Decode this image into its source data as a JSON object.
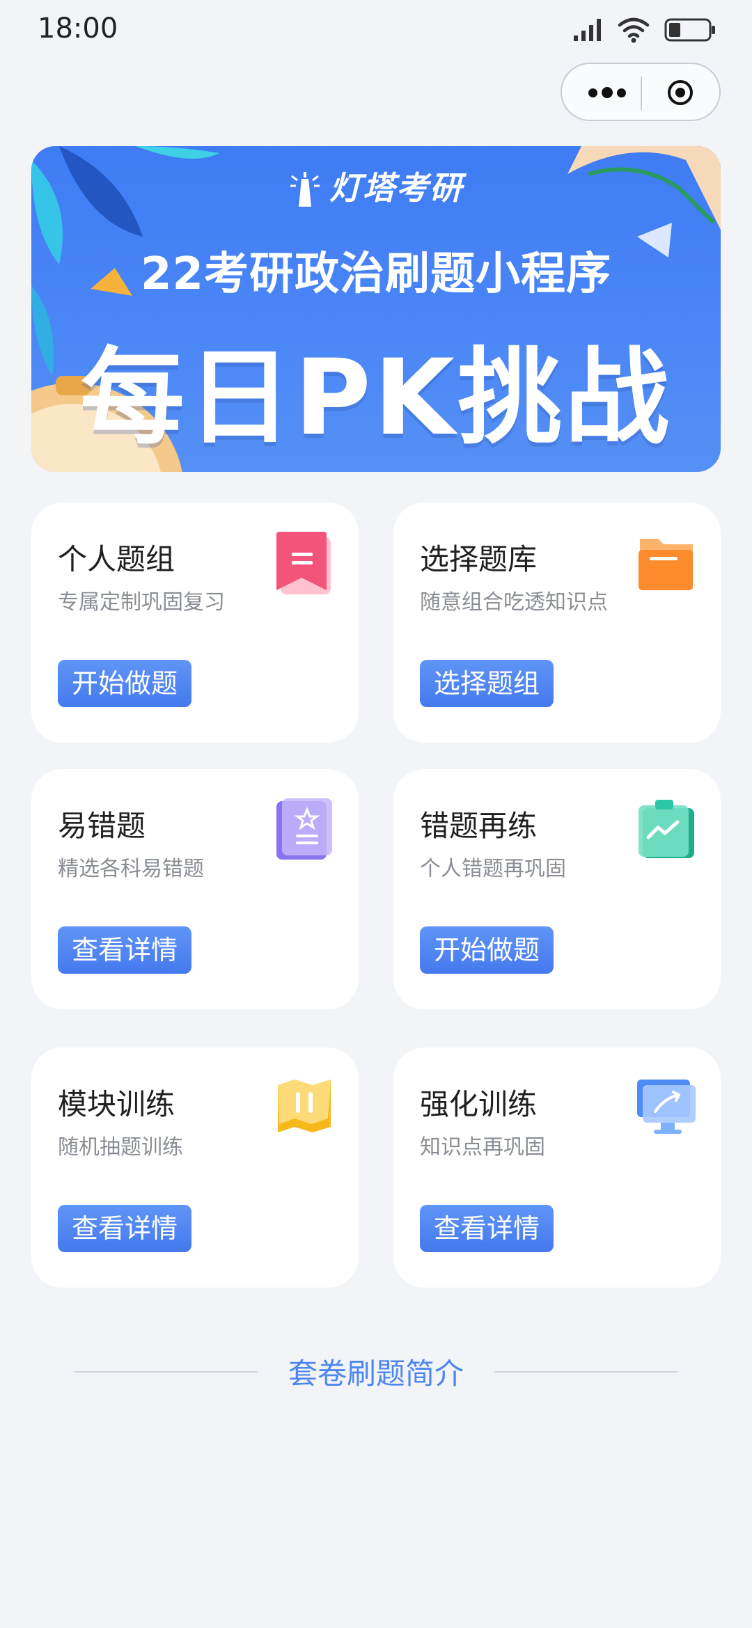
{
  "status_bar": {
    "time": "18:00",
    "icons": [
      "signal-icon",
      "wifi-icon",
      "battery-icon"
    ]
  },
  "capsule": {
    "icons": [
      "more-icon",
      "close-target-icon"
    ]
  },
  "banner": {
    "brand": "灯塔考研",
    "subtitle": "22考研政治刷题小程序",
    "title": "每日PK挑战"
  },
  "cards": [
    {
      "title": "个人题组",
      "desc": "专属定制巩固复习",
      "button": "开始做题",
      "icon": "bookmark-icon",
      "color": "#f3557a"
    },
    {
      "title": "选择题库",
      "desc": "随意组合吃透知识点",
      "button": "选择题组",
      "icon": "folder-icon",
      "color": "#fb8b2c"
    },
    {
      "title": "易错题",
      "desc": "精选各科易错题",
      "button": "查看详情",
      "icon": "star-note-icon",
      "color": "#8a73ee"
    },
    {
      "title": "错题再练",
      "desc": "个人错题再巩固",
      "button": "开始做题",
      "icon": "clipboard-chart-icon",
      "color": "#2bc6a4"
    },
    {
      "title": "模块训练",
      "desc": "随机抽题训练",
      "button": "查看详情",
      "icon": "map-icon",
      "color": "#f7b81c"
    },
    {
      "title": "强化训练",
      "desc": "知识点再巩固",
      "button": "查看详情",
      "icon": "monitor-icon",
      "color": "#4d8cf5"
    }
  ],
  "footer": {
    "intro": "套卷刷题简介"
  },
  "colors": {
    "accent": "#4a7ff0",
    "background": "#f2f4f8"
  }
}
